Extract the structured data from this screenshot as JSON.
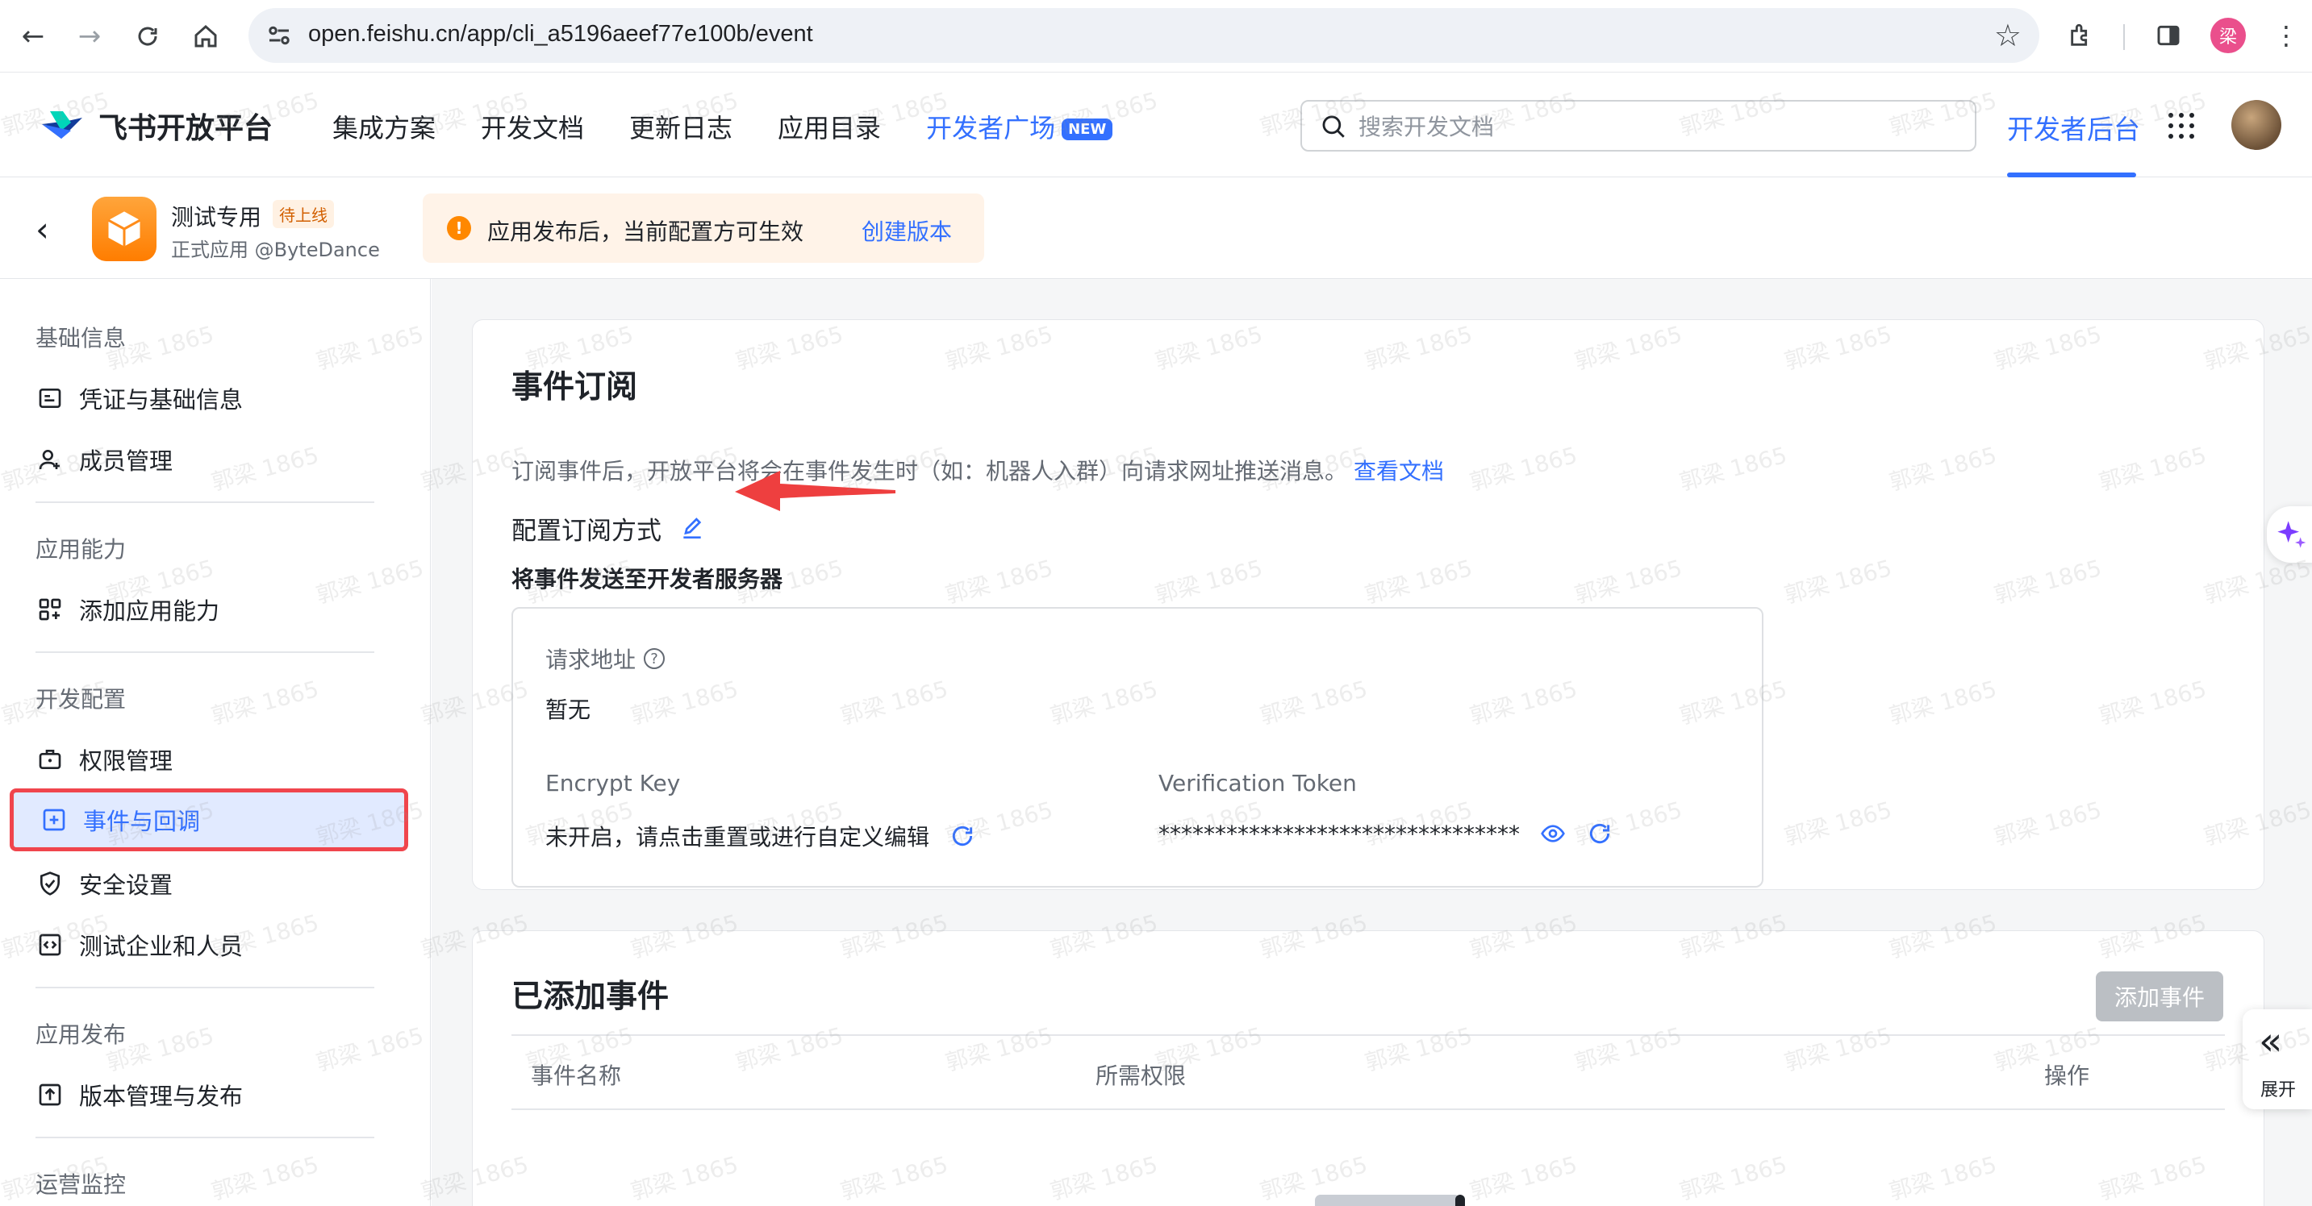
{
  "browser": {
    "url": "open.feishu.cn/app/cli_a5196aeef77e100b/event",
    "profile_initial": "梁"
  },
  "header": {
    "logo_text": "飞书开放平台",
    "nav": [
      {
        "label": "集成方案"
      },
      {
        "label": "开发文档"
      },
      {
        "label": "更新日志"
      },
      {
        "label": "应用目录"
      },
      {
        "label": "开发者广场",
        "badge": "NEW"
      }
    ],
    "search_placeholder": "搜索开发文档",
    "dev_backend": "开发者后台"
  },
  "app_bar": {
    "app_name": "测试专用",
    "status_badge": "待上线",
    "app_sub": "正式应用 @ByteDance",
    "notice": "应用发布后，当前配置方可生效",
    "notice_link": "创建版本"
  },
  "sidebar": {
    "groups": [
      {
        "title": "基础信息",
        "items": [
          {
            "label": "凭证与基础信息",
            "icon": "id-card-icon"
          },
          {
            "label": "成员管理",
            "icon": "add-user-icon"
          }
        ]
      },
      {
        "title": "应用能力",
        "items": [
          {
            "label": "添加应用能力",
            "icon": "apps-add-icon"
          }
        ]
      },
      {
        "title": "开发配置",
        "items": [
          {
            "label": "权限管理",
            "icon": "briefcase-icon"
          },
          {
            "label": "事件与回调",
            "icon": "event-icon",
            "active": true
          },
          {
            "label": "安全设置",
            "icon": "shield-icon"
          },
          {
            "label": "测试企业和人员",
            "icon": "code-icon"
          }
        ]
      },
      {
        "title": "应用发布",
        "items": [
          {
            "label": "版本管理与发布",
            "icon": "upload-icon"
          }
        ]
      },
      {
        "title": "运营监控",
        "items": []
      }
    ]
  },
  "event_subscription": {
    "title": "事件订阅",
    "description": "订阅事件后，开放平台将会在事件发生时（如：机器人入群）向请求网址推送消息。",
    "doc_link": "查看文档",
    "config_title": "配置订阅方式",
    "mode": "将事件发送至开发者服务器",
    "request_url_label": "请求地址",
    "request_url_value": "暂无",
    "encrypt_key_label": "Encrypt Key",
    "encrypt_key_value": "未开启，请点击重置或进行自定义编辑",
    "verification_token_label": "Verification Token",
    "verification_token_value": "********************************"
  },
  "added_events": {
    "title": "已添加事件",
    "add_button": "添加事件",
    "columns": [
      "事件名称",
      "所需权限",
      "操作"
    ]
  },
  "floating": {
    "expand_label": "展开"
  },
  "watermark": "郭梁 1865",
  "colors": {
    "accent": "#3370ff",
    "highlight_border": "#f0454d",
    "notice_bg": "#fff3e8",
    "warning": "#ff8800",
    "app_icon": "#ff8c1a"
  }
}
